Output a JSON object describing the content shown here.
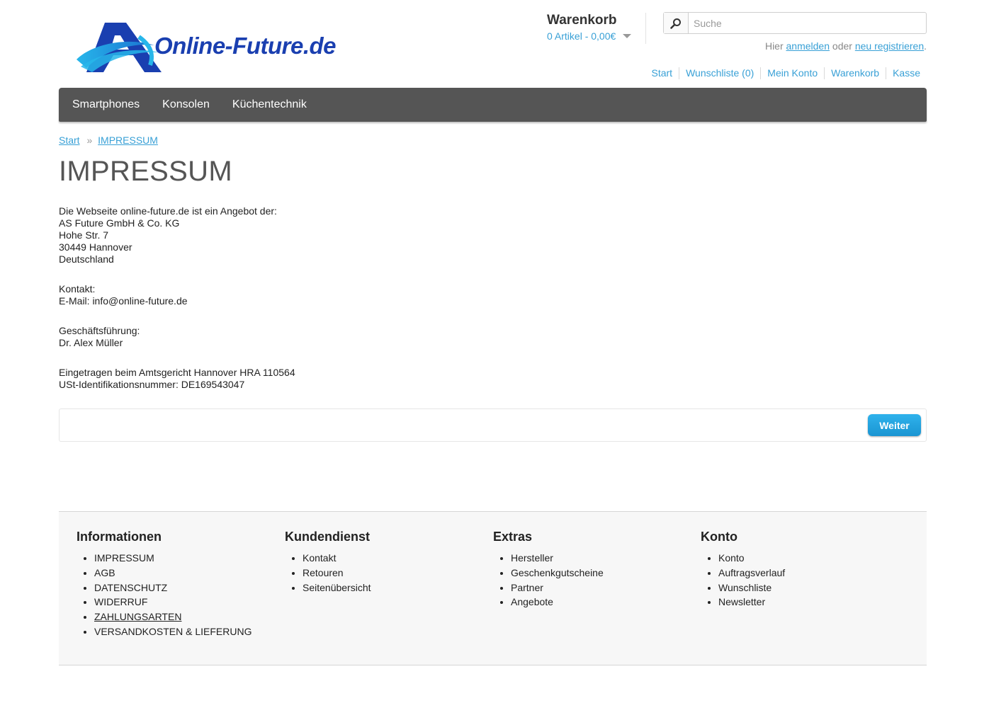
{
  "logo": {
    "text": "Online-Future.de"
  },
  "cart": {
    "title": "Warenkorb",
    "summary": "0 Artikel - 0,00€"
  },
  "search": {
    "placeholder": "Suche"
  },
  "login": {
    "prefix": "Hier",
    "login_link": "anmelden",
    "middle": "oder",
    "register_link": "neu registrieren",
    "suffix": "."
  },
  "top_links": [
    "Start",
    "Wunschliste (0)",
    "Mein Konto",
    "Warenkorb",
    "Kasse"
  ],
  "nav": [
    "Smartphones",
    "Konsolen",
    "Küchentechnik"
  ],
  "breadcrumb": {
    "home": "Start",
    "sep": "»",
    "current": "IMPRESSUM"
  },
  "page_title": "IMPRESSUM",
  "content": {
    "intro": "Die Webseite online-future.de ist ein Angebot der:",
    "company": "AS Future GmbH & Co. KG",
    "street": "Hohe Str. 7",
    "city": "30449 Hannover",
    "country": "Deutschland",
    "contact_label": "Kontakt:",
    "email": "E-Mail: info@online-future.de",
    "management_label": "Geschäftsführung:",
    "manager": "Dr. Alex Müller",
    "register": "Eingetragen beim Amtsgericht Hannover HRA 110564",
    "vat": "USt-Identifikationsnummer: DE169543047"
  },
  "continue_button": "Weiter",
  "footer": {
    "informationen": {
      "title": "Informationen",
      "items": [
        "IMPRESSUM",
        "AGB",
        "DATENSCHUTZ",
        "WIDERRUF",
        "ZAHLUNGSARTEN",
        "VERSANDKOSTEN & LIEFERUNG"
      ]
    },
    "kundendienst": {
      "title": "Kundendienst",
      "items": [
        "Kontakt",
        "Retouren",
        "Seitenübersicht"
      ]
    },
    "extras": {
      "title": "Extras",
      "items": [
        "Hersteller",
        "Geschenkgutscheine",
        "Partner",
        "Angebote"
      ]
    },
    "konto": {
      "title": "Konto",
      "items": [
        "Konto",
        "Auftragsverlauf",
        "Wunschliste",
        "Newsletter"
      ]
    }
  },
  "colors": {
    "link": "#38a0d6",
    "nav_bg": "#555555",
    "button": "#1ea3df",
    "logo_blue": "#1a3fb0"
  }
}
